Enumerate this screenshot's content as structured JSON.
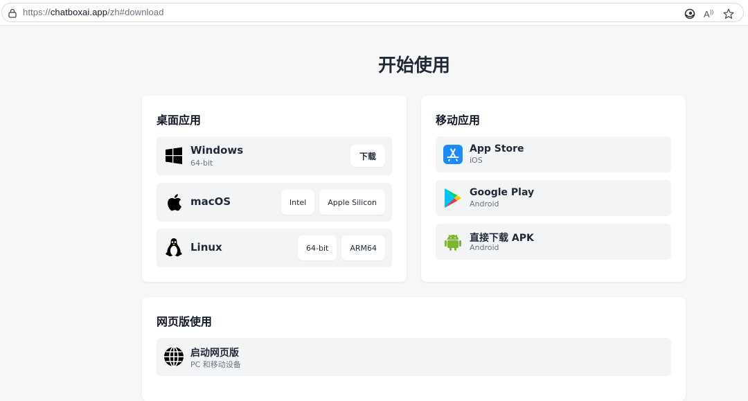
{
  "browser": {
    "url_prefix": "https://",
    "url_host": "chatboxai.app",
    "url_path": "/zh#download"
  },
  "page": {
    "title": "开始使用"
  },
  "desktop": {
    "title": "桌面应用",
    "windows": {
      "name": "Windows",
      "sub": "64-bit",
      "button": "下载"
    },
    "macos": {
      "name": "macOS",
      "buttons": [
        "Intel",
        "Apple Silicon"
      ]
    },
    "linux": {
      "name": "Linux",
      "buttons": [
        "64-bit",
        "ARM64"
      ]
    }
  },
  "mobile": {
    "title": "移动应用",
    "appstore": {
      "name": "App Store",
      "sub": "iOS"
    },
    "googleplay": {
      "name": "Google Play",
      "sub": "Android"
    },
    "apk": {
      "name": "直接下载 APK",
      "sub": "Android"
    }
  },
  "web": {
    "title": "网页版使用",
    "launch": {
      "name": "启动网页版",
      "sub": "PC 和移动设备"
    }
  },
  "colors": {
    "appstore_blue": "#1a8cff",
    "android_green": "#7cb82f"
  }
}
